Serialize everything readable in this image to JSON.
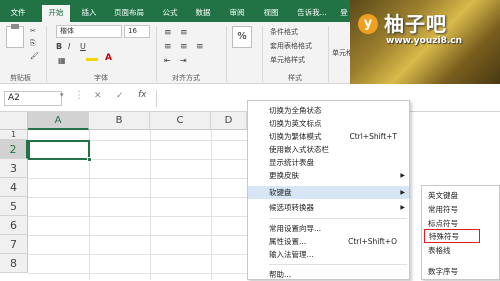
{
  "tabs": [
    {
      "label": "文件",
      "active": false
    },
    {
      "label": "开始",
      "active": true
    },
    {
      "label": "插入",
      "active": false
    },
    {
      "label": "页面布局",
      "active": false
    },
    {
      "label": "公式",
      "active": false
    },
    {
      "label": "数据",
      "active": false
    },
    {
      "label": "审阅",
      "active": false
    },
    {
      "label": "视图",
      "active": false
    },
    {
      "label": "告诉我...",
      "active": false
    },
    {
      "label": "登",
      "active": false
    }
  ],
  "ribbon": {
    "font_name": "楷体",
    "font_size": "16",
    "percent": "%",
    "conditional_format": "条件格式",
    "table_format": "套用表格格式",
    "cell_style": "单元格样式",
    "cells": "单元格",
    "groups": {
      "clipboard": "剪贴板",
      "font": "字体",
      "alignment": "对齐方式",
      "styles": "样式"
    }
  },
  "formula_bar": {
    "name_box": "A2",
    "fx": "fx",
    "cancel": "✕",
    "confirm": "✓"
  },
  "columns": [
    "A",
    "B",
    "C",
    "D"
  ],
  "rows": [
    "1",
    "2",
    "3",
    "4",
    "5",
    "6",
    "7",
    "8"
  ],
  "watermark": {
    "brand": "柚子吧",
    "url": "www.youzi8.cn",
    "logo_letter": "y"
  },
  "context_menu": {
    "items": [
      {
        "label": "切换为全角状态",
        "shortcut": "",
        "arrow": false
      },
      {
        "label": "切换为英文标点",
        "shortcut": "",
        "arrow": false
      },
      {
        "label": "切换为繁体模式",
        "shortcut": "Ctrl+Shift+T",
        "arrow": false
      },
      {
        "label": "使用嵌入式状态栏",
        "shortcut": "",
        "arrow": false
      },
      {
        "label": "显示统计表盘",
        "shortcut": "",
        "arrow": false
      },
      {
        "label": "更换皮肤",
        "shortcut": "",
        "arrow": true
      },
      {
        "label": "软键盘",
        "shortcut": "",
        "arrow": true,
        "highlighted": true
      },
      {
        "label": "候选项转换器",
        "shortcut": "",
        "arrow": true
      },
      {
        "label": "常用设置向导...",
        "shortcut": "",
        "arrow": false
      },
      {
        "label": "属性设置...",
        "shortcut": "Ctrl+Shift+O",
        "arrow": false
      },
      {
        "label": "输入法管理...",
        "shortcut": "",
        "arrow": false
      },
      {
        "label": "帮助...",
        "shortcut": "",
        "arrow": false
      }
    ]
  },
  "sub_menu": {
    "items": [
      {
        "label": "英文键盘",
        "selected": false
      },
      {
        "label": "常用符号",
        "selected": false
      },
      {
        "label": "标点符号",
        "selected": false
      },
      {
        "label": "特殊符号",
        "selected": true
      },
      {
        "label": "表格线",
        "selected": false
      },
      {
        "label": "数字序号",
        "selected": false
      }
    ]
  },
  "colors": {
    "excel_green": "#217346",
    "highlight": "#d6e6f5",
    "selected_box": "#e02020"
  }
}
